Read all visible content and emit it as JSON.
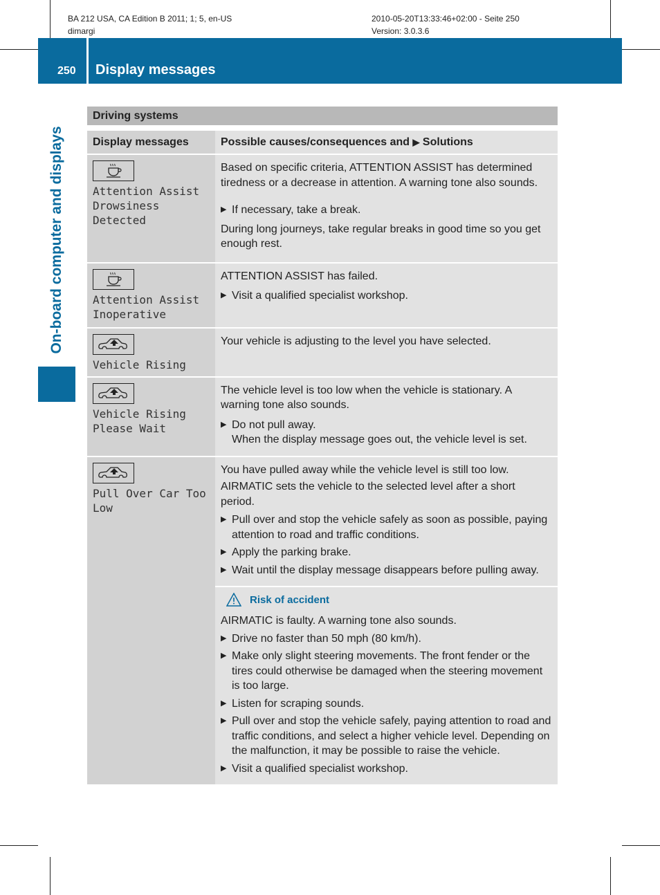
{
  "meta": {
    "left_line1": "BA 212 USA, CA Edition B 2011; 1; 5, en-US",
    "left_line2": "dimargi",
    "right_line1": "2010-05-20T13:33:46+02:00 - Seite 250",
    "right_line2": "Version: 3.0.3.6"
  },
  "header": {
    "page_number": "250",
    "title": "Display messages"
  },
  "side_tab": {
    "label": "On-board computer and displays"
  },
  "colors": {
    "brand_blue": "#0a6b9e",
    "section_gray": "#b8b8b8",
    "col1_gray": "#d2d2d2",
    "col2_gray": "#e2e2e2"
  },
  "section": {
    "title": "Driving systems"
  },
  "table": {
    "headers": {
      "col1": "Display messages",
      "col2_pre": "Possible causes/consequences and",
      "col2_post": "Solutions"
    },
    "rows": [
      {
        "icon": "coffee-cup-icon",
        "message": "Attention Assist\nDrowsiness\nDetected",
        "p1": "Based on specific criteria, ATTENTION ASSIST has determined tiredness or a decrease in attention. A warning tone also sounds.",
        "b1": "If necessary, take a break.",
        "p2": "During long journeys, take regular breaks in good time so you get enough rest."
      },
      {
        "icon": "coffee-cup-icon",
        "message": "Attention Assist\nInoperative",
        "p1": "ATTENTION ASSIST has failed.",
        "b1": "Visit a qualified specialist workshop."
      },
      {
        "icon": "vehicle-rising-icon",
        "message": "Vehicle Rising",
        "p1": "Your vehicle is adjusting to the level you have selected."
      },
      {
        "icon": "vehicle-rising-icon",
        "message": "Vehicle Rising\nPlease Wait",
        "p1": "The vehicle level is too low when the vehicle is stationary. A warning tone also sounds.",
        "b1": "Do not pull away.",
        "b1_cont": "When the display message goes out, the vehicle level is set."
      },
      {
        "icon": "vehicle-rising-icon",
        "message": "Pull Over Car Too\nLow",
        "p1": "You have pulled away while the vehicle level is still too low.",
        "p2": "AIRMATIC sets the vehicle to the selected level after a short period.",
        "b1": "Pull over and stop the vehicle safely as soon as possible, paying attention to road and traffic conditions.",
        "b2": "Apply the parking brake.",
        "b3": "Wait until the display message disappears before pulling away.",
        "warning": {
          "title": "Risk of accident",
          "p1": "AIRMATIC is faulty. A warning tone also sounds.",
          "b1": "Drive no faster than 50 mph (80 km/h).",
          "b2": "Make only slight steering movements. The front fender or the tires could otherwise be damaged when the steering movement is too large.",
          "b3": "Listen for scraping sounds.",
          "b4": "Pull over and stop the vehicle safely, paying attention to road and traffic conditions, and select a higher vehicle level. Depending on the malfunction, it may be possible to raise the vehicle.",
          "b5": "Visit a qualified specialist workshop."
        }
      }
    ]
  }
}
